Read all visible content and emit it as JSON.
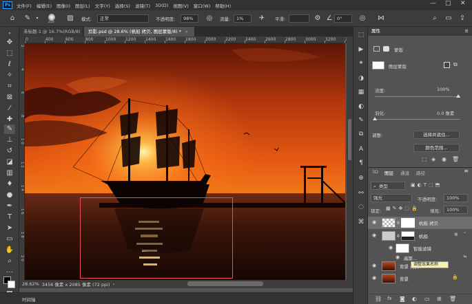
{
  "menubar": {
    "logo": "Ps",
    "items": [
      "文件(F)",
      "编辑(E)",
      "图像(I)",
      "图层(L)",
      "文字(Y)",
      "选择(S)",
      "滤镜(T)",
      "3D(D)",
      "视图(V)",
      "窗口(W)",
      "帮助(H)"
    ],
    "win_controls": [
      "—",
      "□",
      "✕"
    ]
  },
  "optbar": {
    "brush_size": "250",
    "mode_label": "模式:",
    "mode_value": "正常",
    "opacity_label": "不透明度:",
    "opacity_value": "98%",
    "flow_label": "流量:",
    "flow_value": "1%",
    "smooth_label": "平滑:",
    "smooth_value": "",
    "angle_value": "0°"
  },
  "tabs": [
    {
      "label": "未标题-1 @ 16.7%(RGB/8)",
      "active": false
    },
    {
      "label": "剪影.psd @ 28.6% (帆船 拷贝, 图层蒙版/8) *",
      "active": true
    }
  ],
  "ruler": {
    "h_labels": [
      "0",
      "400",
      "600",
      "800",
      "1000",
      "1200",
      "1400",
      "1600",
      "1800",
      "2000",
      "2200",
      "2400",
      "2600",
      "2800",
      "3000",
      "3200",
      "3400"
    ],
    "v_labels": [
      "2",
      "4",
      "6",
      "8",
      "1 0",
      "1 2",
      "1 4",
      "1 6",
      "1 8",
      "2 0"
    ]
  },
  "status": {
    "zoom": "28.62%",
    "doc_info": "3456 像素 x 2085 像素 (72 ppi)",
    "arrow": "›"
  },
  "timeline": {
    "label": "时间轴"
  },
  "properties": {
    "tab": "属性",
    "sub_tab": "蒙版",
    "mask_label": "图层蒙版",
    "density_label": "浓度:",
    "density_value": "100%",
    "feather_label": "羽化:",
    "feather_value": "0.0 像素",
    "adjust_label": "调整:",
    "select_btn": "选择并遮住...",
    "color_range_btn": "颜色范围..."
  },
  "layers_panel": {
    "tabs": [
      "3D",
      "图层",
      "通道",
      "路径"
    ],
    "kind_label": "类型",
    "blend_mode": "强光",
    "opacity_label": "不透明度:",
    "opacity_value": "100%",
    "lock_label": "锁定:",
    "fill_label": "填充:",
    "fill_value": "100%",
    "layers": [
      {
        "name": "帆船 拷贝",
        "selected": true
      },
      {
        "name": "帆船",
        "selected": false
      },
      {
        "name": "智能滤镜",
        "selected": false
      },
      {
        "name": "高斯...",
        "selected": false
      },
      {
        "name": "背景 拷贝",
        "selected": false
      },
      {
        "name": "背景",
        "selected": false
      }
    ],
    "tooltip": "调整效果名称"
  },
  "colors": {
    "sky_top": "#5a1606",
    "sun": "#ffcc55",
    "accent": "#31a8ff",
    "selection": "#e8505e"
  }
}
